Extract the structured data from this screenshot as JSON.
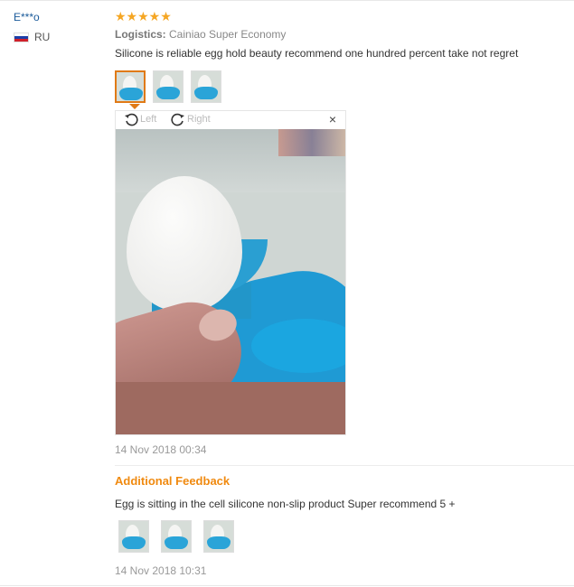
{
  "review": {
    "username": "E***o",
    "country": "RU",
    "rating": "★★★★★",
    "logistics_label": "Logistics:",
    "logistics_value": "Cainiao Super Economy",
    "text": "Silicone is reliable egg hold beauty recommend one hundred percent take not regret",
    "date": "14 Nov 2018 00:34"
  },
  "viewer": {
    "rotate_left": "Left",
    "rotate_right": "Right",
    "close": "×"
  },
  "additional": {
    "title": "Additional Feedback",
    "text": "Egg is sitting in the cell silicone non-slip product Super recommend 5 +",
    "date": "14 Nov 2018 10:31"
  },
  "colors": {
    "accent": "#f08a10",
    "username": "#1a5a9a",
    "star": "#f5a623"
  }
}
